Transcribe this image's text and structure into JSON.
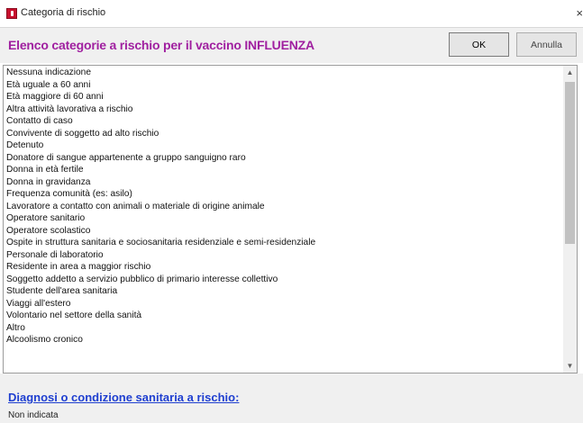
{
  "window": {
    "title": "Categoria di rischio",
    "close_glyph": "×"
  },
  "header": {
    "heading": "Elenco categorie a rischio per il vaccino INFLUENZA",
    "heading_color": "#a020a0",
    "ok_label": "OK",
    "cancel_label": "Annulla"
  },
  "list": {
    "items": [
      "Nessuna indicazione",
      "Età uguale a 60 anni",
      "Età maggiore di 60 anni",
      "Altra attività lavorativa a rischio",
      "Contatto di caso",
      "Convivente di soggetto ad alto rischio",
      "Detenuto",
      "Donatore di sangue appartenente a gruppo sanguigno raro",
      "Donna in età fertile",
      "Donna in gravidanza",
      "Frequenza comunità (es: asilo)",
      "Lavoratore a contatto con animali o materiale di origine animale",
      "Operatore sanitario",
      "Operatore scolastico",
      "Ospite in struttura sanitaria e sociosanitaria residenziale e semi-residenziale",
      "Personale di laboratorio",
      "Residente in area a maggior rischio",
      "Soggetto addetto a servizio pubblico di primario interesse collettivo",
      "Studente dell'area sanitaria",
      "Viaggi all'estero",
      "Volontario nel settore della sanità",
      "Altro",
      "Alcoolismo cronico"
    ]
  },
  "footer": {
    "section_label": "Diagnosi o condizione sanitaria a rischio:",
    "section_color": "#1f3fd0",
    "current_value": "Non indicata"
  }
}
